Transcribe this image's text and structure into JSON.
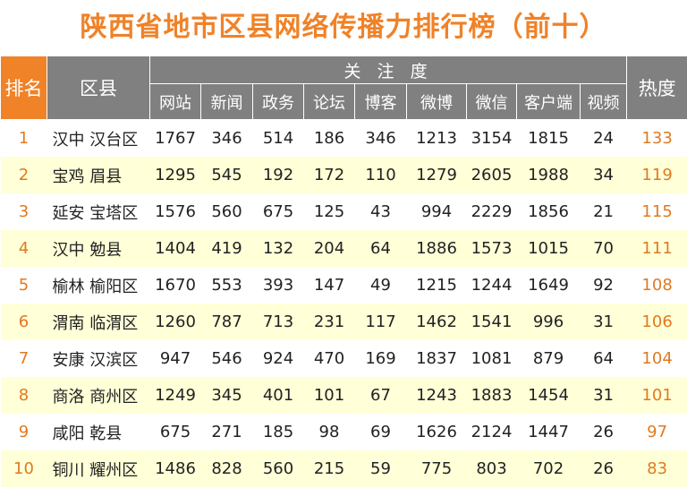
{
  "title": "陕西省地市区县网络传播力排行榜（前十）",
  "header": {
    "rank": "排名",
    "district": "区县",
    "group": "关 注 度",
    "columns": [
      "网站",
      "新闻",
      "政务",
      "论坛",
      "博客",
      "微博",
      "微信",
      "客户端",
      "视频"
    ],
    "heat": "热度"
  },
  "rows": [
    {
      "rank": "1",
      "district": "汉中 汉台区",
      "values": [
        "1767",
        "346",
        "514",
        "186",
        "346",
        "1213",
        "3154",
        "1815",
        "24"
      ],
      "heat": "133"
    },
    {
      "rank": "2",
      "district": "宝鸡 眉县",
      "values": [
        "1295",
        "545",
        "192",
        "172",
        "110",
        "1279",
        "2605",
        "1988",
        "34"
      ],
      "heat": "119"
    },
    {
      "rank": "3",
      "district": "延安 宝塔区",
      "values": [
        "1576",
        "560",
        "675",
        "125",
        "43",
        "994",
        "2229",
        "1856",
        "21"
      ],
      "heat": "115"
    },
    {
      "rank": "4",
      "district": "汉中 勉县",
      "values": [
        "1404",
        "419",
        "132",
        "204",
        "64",
        "1886",
        "1573",
        "1015",
        "70"
      ],
      "heat": "111"
    },
    {
      "rank": "5",
      "district": "榆林 榆阳区",
      "values": [
        "1670",
        "553",
        "393",
        "147",
        "49",
        "1215",
        "1244",
        "1649",
        "92"
      ],
      "heat": "108"
    },
    {
      "rank": "6",
      "district": "渭南 临渭区",
      "values": [
        "1260",
        "787",
        "713",
        "231",
        "117",
        "1462",
        "1541",
        "996",
        "31"
      ],
      "heat": "106"
    },
    {
      "rank": "7",
      "district": "安康 汉滨区",
      "values": [
        "947",
        "546",
        "924",
        "470",
        "169",
        "1837",
        "1081",
        "879",
        "64"
      ],
      "heat": "104"
    },
    {
      "rank": "8",
      "district": "商洛 商州区",
      "values": [
        "1249",
        "345",
        "401",
        "101",
        "67",
        "1243",
        "1883",
        "1454",
        "31"
      ],
      "heat": "101"
    },
    {
      "rank": "9",
      "district": "咸阳 乾县",
      "values": [
        "675",
        "271",
        "185",
        "98",
        "69",
        "1626",
        "2124",
        "1447",
        "26"
      ],
      "heat": "97"
    },
    {
      "rank": "10",
      "district": "铜川 耀州区",
      "values": [
        "1486",
        "828",
        "560",
        "215",
        "59",
        "775",
        "803",
        "702",
        "26"
      ],
      "heat": "83"
    }
  ]
}
